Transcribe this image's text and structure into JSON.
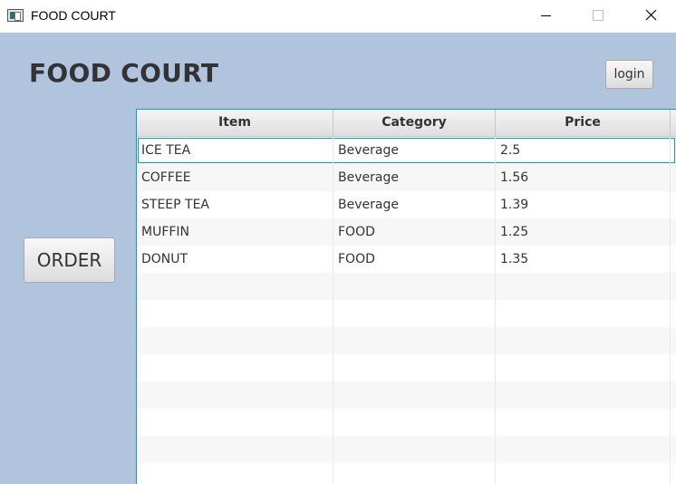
{
  "window": {
    "title": "FOOD COURT",
    "icon": "app-window-icon",
    "controls": [
      "minimize-icon",
      "maximize-icon",
      "close-icon"
    ]
  },
  "header": {
    "title": "FOOD COURT",
    "login_label": "login"
  },
  "sidebar": {
    "order_label": "ORDER"
  },
  "table": {
    "columns": [
      "Item",
      "Category",
      "Price"
    ],
    "rows": [
      [
        "ICE TEA",
        "Beverage",
        "2.5"
      ],
      [
        "COFFEE",
        "Beverage",
        "1.56"
      ],
      [
        "STEEP TEA",
        "Beverage",
        "1.39"
      ],
      [
        "MUFFIN",
        "FOOD",
        "1.25"
      ],
      [
        "DONUT",
        "FOOD",
        "1.35"
      ]
    ],
    "selected_row": 0
  },
  "colors": {
    "background": "#b0c4de",
    "accent": "#039ed3",
    "heading": "#333333"
  }
}
